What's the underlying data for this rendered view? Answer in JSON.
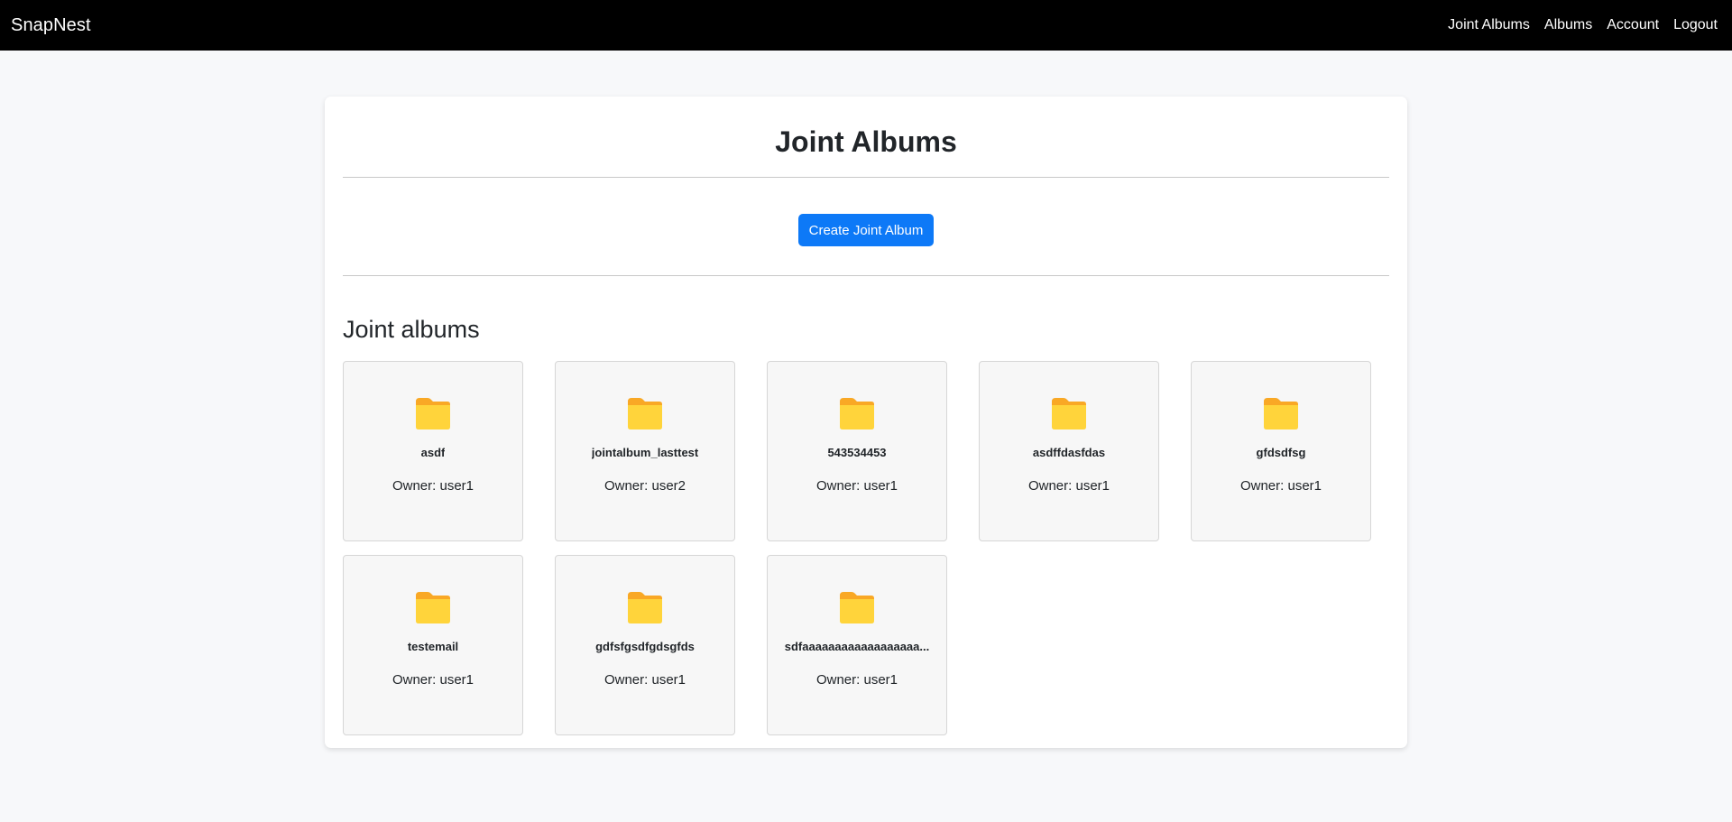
{
  "navbar": {
    "brand": "SnapNest",
    "links": [
      "Joint Albums",
      "Albums",
      "Account",
      "Logout"
    ]
  },
  "page": {
    "title": "Joint Albums",
    "create_button_label": "Create Joint Album",
    "section_title": "Joint albums"
  },
  "albums": [
    {
      "name": "asdf",
      "owner": "Owner: user1"
    },
    {
      "name": "jointalbum_lasttest",
      "owner": "Owner: user2"
    },
    {
      "name": "543534453",
      "owner": "Owner: user1"
    },
    {
      "name": "asdffdasfdas",
      "owner": "Owner: user1"
    },
    {
      "name": "gfdsdfsg",
      "owner": "Owner: user1"
    },
    {
      "name": "testemail",
      "owner": "Owner: user1"
    },
    {
      "name": "gdfsfgsdfgdsgfds",
      "owner": "Owner: user1"
    },
    {
      "name": "sdfaaaaaaaaaaaaaaaaaa...",
      "owner": "Owner: user1"
    }
  ],
  "icons": {
    "album": "folder-icon"
  },
  "colors": {
    "navbar_bg": "#000000",
    "primary_button": "#0d79f7",
    "folder_front": "#FFD43B",
    "folder_back": "#F9A825"
  }
}
